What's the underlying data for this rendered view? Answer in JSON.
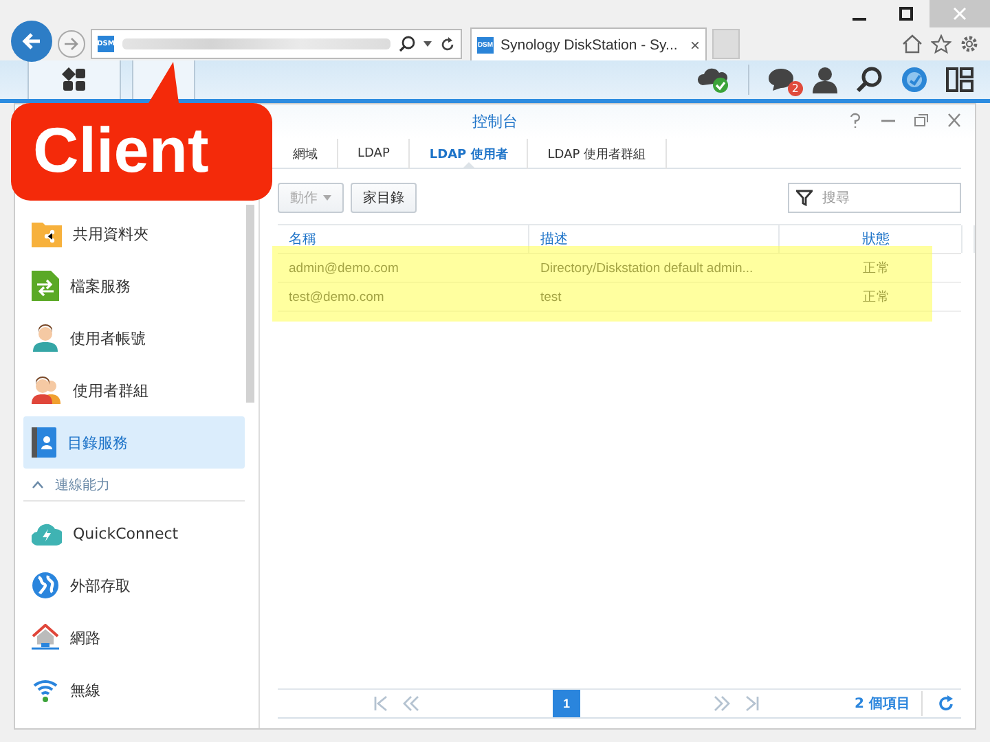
{
  "browser": {
    "tab_title": "Synology DiskStation - Sy...",
    "favicon": "DSM",
    "tab_favicon": "DSM",
    "tab_close": "×"
  },
  "taskbar": {
    "notification_count": "2"
  },
  "window": {
    "title": "控制台"
  },
  "tabs": [
    {
      "label": "網域",
      "selected": false
    },
    {
      "label": "LDAP",
      "selected": false
    },
    {
      "label": "LDAP 使用者",
      "selected": true
    },
    {
      "label": "LDAP 使用者群組",
      "selected": false
    }
  ],
  "toolbar": {
    "buttons": [
      {
        "label": "動作",
        "disabled": true,
        "dropdown": true
      },
      {
        "label": "家目錄",
        "disabled": false,
        "dropdown": false
      }
    ],
    "search": {
      "placeholder": "搜尋"
    }
  },
  "sidebar": {
    "items": [
      {
        "kind": "item",
        "label": "共用資料夾",
        "selected": false
      },
      {
        "kind": "item",
        "label": "檔案服務",
        "selected": false
      },
      {
        "kind": "item",
        "label": "使用者帳號",
        "selected": false
      },
      {
        "kind": "item",
        "label": "使用者群組",
        "selected": false
      },
      {
        "kind": "item",
        "label": "目錄服務",
        "selected": true
      },
      {
        "kind": "section",
        "label": "連線能力",
        "expanded": true
      },
      {
        "kind": "item",
        "label": "QuickConnect",
        "selected": false
      },
      {
        "kind": "item",
        "label": "外部存取",
        "selected": false
      },
      {
        "kind": "item",
        "label": "網路",
        "selected": false
      },
      {
        "kind": "item",
        "label": "無線",
        "selected": false
      }
    ]
  },
  "table": {
    "columns": [
      "名稱",
      "描述",
      "狀態"
    ],
    "highlighted": true,
    "rows": [
      {
        "cells": [
          "admin@demo.com",
          "Directory/Diskstation default admin...",
          "正常"
        ]
      },
      {
        "cells": [
          "test@demo.com",
          "test",
          "正常"
        ]
      }
    ]
  },
  "pagination": {
    "page": "1",
    "count": "2 個項目"
  },
  "annotation": {
    "label": "Client"
  }
}
